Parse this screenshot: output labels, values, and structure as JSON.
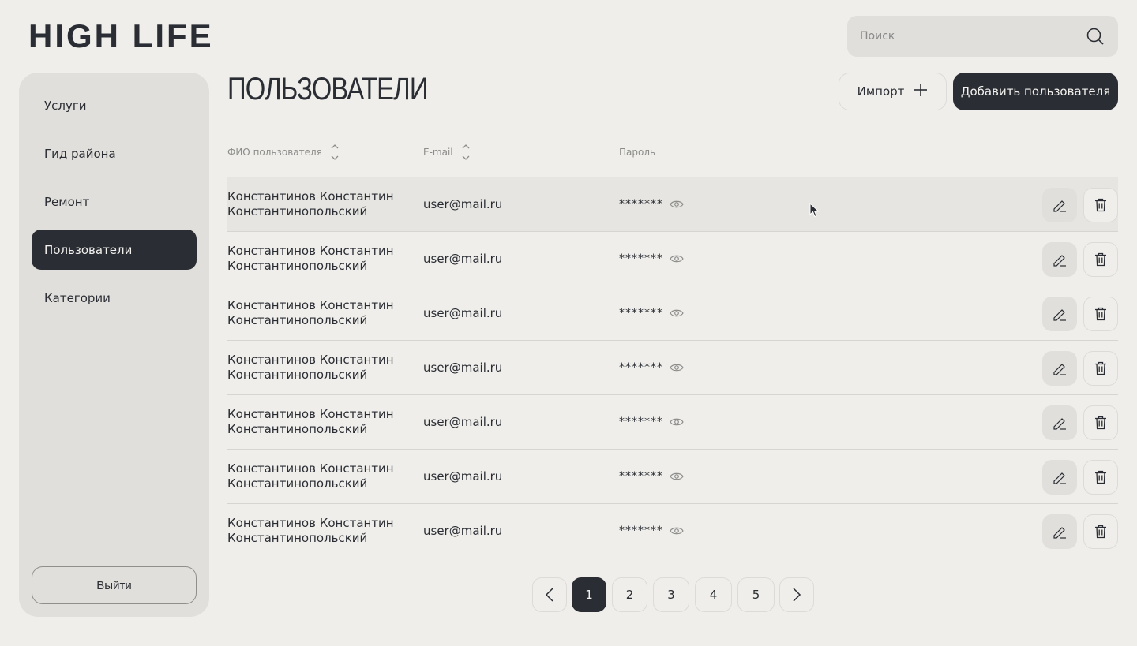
{
  "brand": {
    "logo": "HIGH LIFE"
  },
  "search": {
    "placeholder": "Поиск",
    "icon": "search-icon"
  },
  "sidebar": {
    "items": [
      {
        "label": "Услуги",
        "active": false
      },
      {
        "label": "Гид района",
        "active": false
      },
      {
        "label": "Ремонт",
        "active": false
      },
      {
        "label": "Пользователи",
        "active": true
      },
      {
        "label": "Категории",
        "active": false
      }
    ],
    "logout_label": "Выйти"
  },
  "page": {
    "title": "ПОЛЬЗОВАТЕЛИ",
    "import_label": "Импорт",
    "add_label": "Добавить пользователя"
  },
  "table": {
    "columns": [
      "ФИО пользователя",
      "E-mail",
      "Пароль"
    ],
    "rows": [
      {
        "name_line1": "Константинов Константин",
        "name_line2": "Константинопольский",
        "email": "user@mail.ru",
        "password": "*******"
      },
      {
        "name_line1": "Константинов Константин",
        "name_line2": "Константинопольский",
        "email": "user@mail.ru",
        "password": "*******"
      },
      {
        "name_line1": "Константинов Константин",
        "name_line2": "Константинопольский",
        "email": "user@mail.ru",
        "password": "*******"
      },
      {
        "name_line1": "Константинов Константин",
        "name_line2": "Константинопольский",
        "email": "user@mail.ru",
        "password": "*******"
      },
      {
        "name_line1": "Константинов Константин",
        "name_line2": "Константинопольский",
        "email": "user@mail.ru",
        "password": "*******"
      },
      {
        "name_line1": "Константинов Константин",
        "name_line2": "Константинопольский",
        "email": "user@mail.ru",
        "password": "*******"
      },
      {
        "name_line1": "Константинов Константин",
        "name_line2": "Константинопольский",
        "email": "user@mail.ru",
        "password": "*******"
      }
    ]
  },
  "pagination": {
    "pages": [
      "1",
      "2",
      "3",
      "4",
      "5"
    ],
    "current": "1"
  },
  "colors": {
    "background": "#efeeeb",
    "panel": "#e0dfdb",
    "accent": "#2a2d33"
  }
}
